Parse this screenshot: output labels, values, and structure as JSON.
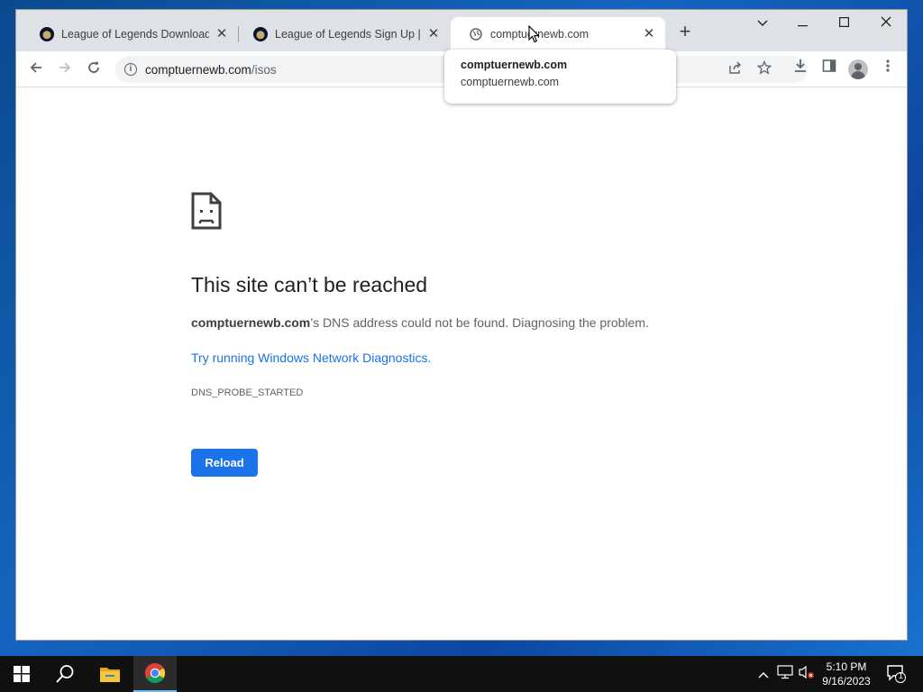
{
  "browser": {
    "tabs": [
      {
        "title": "League of Legends Download | N"
      },
      {
        "title": "League of Legends Sign Up | No"
      },
      {
        "title": "comptuernewb.com"
      }
    ],
    "new_tab_symbol": "+",
    "url_domain": "comptuernewb.com",
    "url_path": "/isos"
  },
  "hover_card": {
    "title": "comptuernewb.com",
    "domain": "comptuernewb.com"
  },
  "error_page": {
    "heading": "This site can’t be reached",
    "host": "comptuernewb.com",
    "description_rest": "’s DNS address could not be found. Diagnosing the problem.",
    "link_text": "Try running Windows Network Diagnostics.",
    "error_code": "DNS_PROBE_STARTED",
    "reload_label": "Reload"
  },
  "taskbar": {
    "time": "5:10 PM",
    "date": "9/16/2023",
    "notification_count": "1"
  },
  "colors": {
    "accent": "#1a73e8",
    "tab_strip": "#dee1e6",
    "taskbar": "#101010"
  },
  "icons": [
    "back-icon",
    "forward-icon",
    "reload-icon",
    "info-icon",
    "share-icon",
    "star-icon",
    "download-icon",
    "side-panel-icon",
    "profile-icon",
    "menu-icon",
    "globe-icon",
    "sad-page-icon",
    "windows-icon",
    "search-icon",
    "file-explorer-icon",
    "chrome-icon",
    "chevron-up-icon",
    "network-icon",
    "volume-icon",
    "notification-icon"
  ]
}
